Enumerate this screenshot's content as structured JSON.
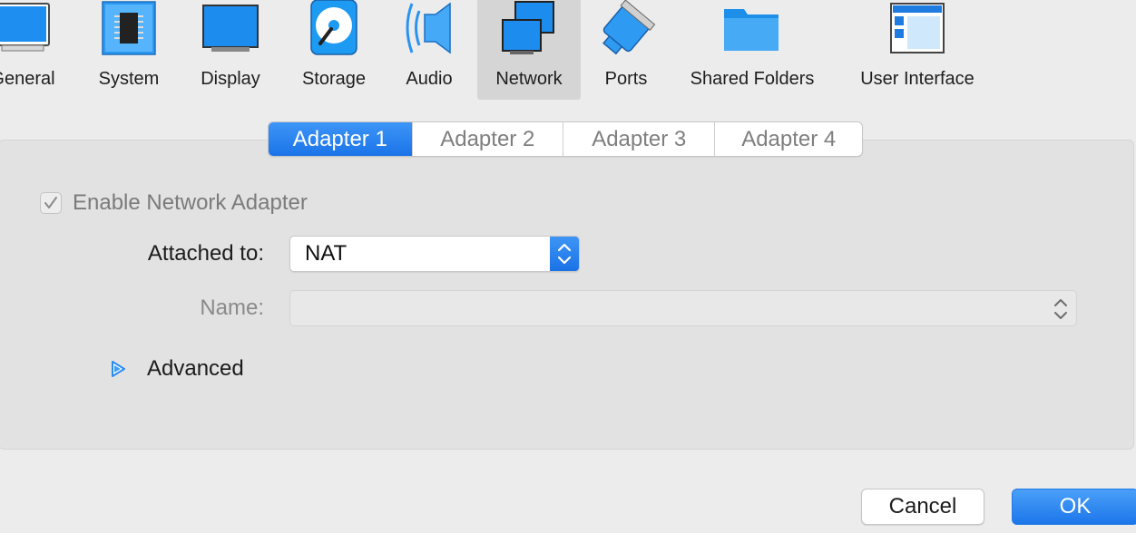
{
  "toolbar": {
    "items": [
      {
        "label": "General",
        "icon": "general-icon"
      },
      {
        "label": "System",
        "icon": "chip-icon"
      },
      {
        "label": "Display",
        "icon": "monitor-icon"
      },
      {
        "label": "Storage",
        "icon": "disk-icon"
      },
      {
        "label": "Audio",
        "icon": "speaker-icon"
      },
      {
        "label": "Network",
        "icon": "network-icon",
        "selected": true
      },
      {
        "label": "Ports",
        "icon": "ports-icon"
      },
      {
        "label": "Shared Folders",
        "icon": "folder-icon"
      },
      {
        "label": "User Interface",
        "icon": "window-icon"
      }
    ]
  },
  "tabs": [
    "Adapter 1",
    "Adapter 2",
    "Adapter 3",
    "Adapter 4"
  ],
  "active_tab": "Adapter 1",
  "enable_adapter": {
    "label": "Enable Network Adapter",
    "checked": true
  },
  "attached_to": {
    "label": "Attached to:",
    "value": "NAT"
  },
  "name": {
    "label": "Name:",
    "value": ""
  },
  "advanced": {
    "label": "Advanced"
  },
  "buttons": {
    "cancel": "Cancel",
    "ok": "OK"
  },
  "colors": {
    "accent": "#1b74e8",
    "background": "#ececec",
    "panel": "#e2e2e2"
  }
}
